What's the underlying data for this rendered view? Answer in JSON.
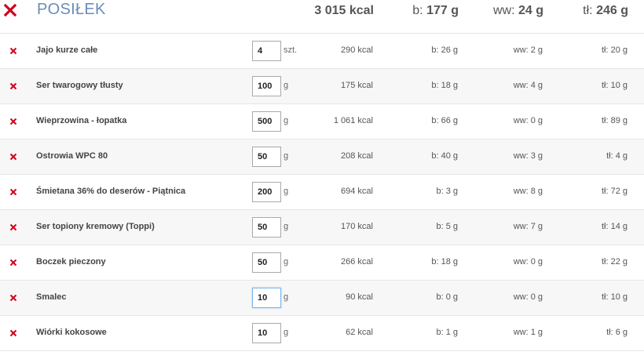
{
  "meal": {
    "title": "POSIŁEK",
    "kcal": "3 015 kcal",
    "b_label": "b:",
    "b_value": "177 g",
    "ww_label": "ww:",
    "ww_value": "24 g",
    "tl_label": "tł:",
    "tl_value": "246 g",
    "accent_color": "#6b8cb8",
    "delete_color": "#d0021b",
    "delete_icon": "close-x-icon"
  },
  "items": [
    {
      "name": "Jajo kurze całe",
      "qty": "4",
      "unit": "szt.",
      "kcal": "290 kcal",
      "b": "b: 26 g",
      "ww": "ww: 2 g",
      "tl": "tł: 20 g"
    },
    {
      "name": "Ser twarogowy tłusty",
      "qty": "100",
      "unit": "g",
      "kcal": "175 kcal",
      "b": "b: 18 g",
      "ww": "ww: 4 g",
      "tl": "tł: 10 g"
    },
    {
      "name": "Wieprzowina - łopatka",
      "qty": "500",
      "unit": "g",
      "kcal": "1 061 kcal",
      "b": "b: 66 g",
      "ww": "ww: 0 g",
      "tl": "tł: 89 g"
    },
    {
      "name": "Ostrowia WPC 80",
      "qty": "50",
      "unit": "g",
      "kcal": "208 kcal",
      "b": "b: 40 g",
      "ww": "ww: 3 g",
      "tl": "tł: 4 g"
    },
    {
      "name": "Śmietana 36% do deserów - Piątnica",
      "qty": "200",
      "unit": "g",
      "kcal": "694 kcal",
      "b": "b: 3 g",
      "ww": "ww: 8 g",
      "tl": "tł: 72 g"
    },
    {
      "name": "Ser topiony kremowy (Toppi)",
      "qty": "50",
      "unit": "g",
      "kcal": "170 kcal",
      "b": "b: 5 g",
      "ww": "ww: 7 g",
      "tl": "tł: 14 g"
    },
    {
      "name": "Boczek pieczony",
      "qty": "50",
      "unit": "g",
      "kcal": "266 kcal",
      "b": "b: 18 g",
      "ww": "ww: 0 g",
      "tl": "tł: 22 g"
    },
    {
      "name": "Smalec",
      "qty": "10",
      "unit": "g",
      "kcal": "90 kcal",
      "b": "b: 0 g",
      "ww": "ww: 0 g",
      "tl": "tł: 10 g",
      "focused": true
    },
    {
      "name": "Wiórki kokosowe",
      "qty": "10",
      "unit": "g",
      "kcal": "62 kcal",
      "b": "b: 1 g",
      "ww": "ww: 1 g",
      "tl": "tł: 6 g"
    }
  ]
}
